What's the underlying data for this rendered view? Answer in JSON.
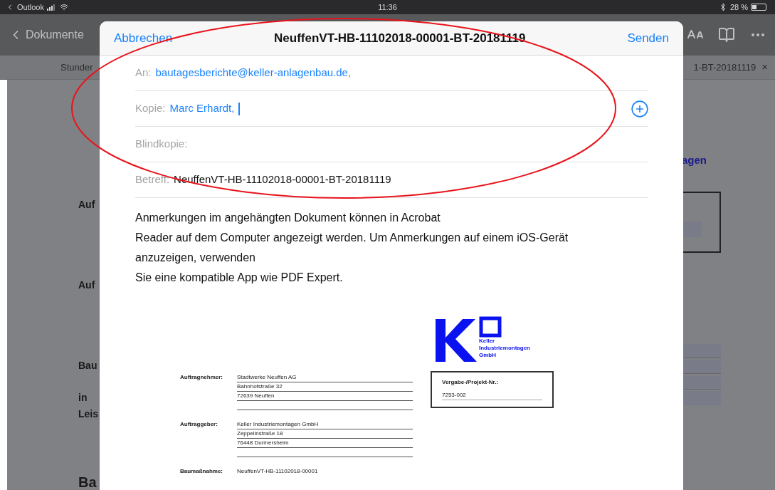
{
  "status_bar": {
    "app": "Outlook",
    "time": "11:36",
    "battery": "28 %"
  },
  "nav_bar": {
    "back": "Dokumente"
  },
  "tab_bar": {
    "left_tab": "Stunder",
    "right_tab": "1-BT-20181119",
    "close": "×"
  },
  "background_document": {
    "left_texts": [
      {
        "text": "Auf",
        "kind": "label"
      },
      {
        "text": "Auf",
        "kind": "label"
      },
      {
        "text": "Bau",
        "kind": "label"
      },
      {
        "text": "in",
        "kind": "label"
      },
      {
        "text": "Leis",
        "kind": "label"
      },
      {
        "text": "Ba",
        "kind": "heading"
      }
    ],
    "right_heading": "agen"
  },
  "compose": {
    "cancel": "Abbrechen",
    "title": "NeuffenVT-HB-11102018-00001-BT-20181119",
    "send": "Senden",
    "fields": [
      {
        "label": "An:",
        "value": "bautagesberichte@keller-anlagenbau.de,",
        "kind": "recipient",
        "focused": false,
        "add_button": false
      },
      {
        "label": "Kopie:",
        "value": "Marc Erhardt,",
        "kind": "recipient",
        "focused": true,
        "add_button": true
      },
      {
        "label": "Blindkopie:",
        "kind": "recipient",
        "focused": false,
        "add_button": false
      },
      {
        "label": "Betreff:",
        "value": "NeuffenVT-HB-11102018-00001-BT-20181119",
        "kind": "subject",
        "focused": false,
        "add_button": false
      }
    ],
    "body": [
      "Anmerkungen im angehängten Dokument können in Acrobat",
      "Reader auf dem Computer angezeigt werden. Um Anmerkungen auf einem iOS-Gerät",
      "anzuzeigen, verwenden",
      "Sie eine kompatible App wie PDF Expert."
    ],
    "attachment": {
      "logo_lines": [
        "Keller",
        "Industriemontagen",
        "GmbH"
      ],
      "parties": [
        {
          "label": "Auftragnehmer:",
          "lines": [
            "Stadtwerke Neuffen AG",
            "Bahnhofstraße 32",
            "72639 Neuffen"
          ]
        },
        {
          "label": "Auftraggeber:",
          "lines": [
            "Keller Industriemontagen GmbH",
            "Zeppelinstraße 18",
            "76448 Durmersheim"
          ]
        }
      ],
      "project_label": "Vergabe-/Projekt-Nr.:",
      "project_number": "7253-002",
      "measure_label": "Baumaßnahme:",
      "measure_value": "NeuffenVT-HB-11102018-00001"
    }
  },
  "annotation": {
    "kind": "ellipse",
    "color": "#e8141c"
  }
}
